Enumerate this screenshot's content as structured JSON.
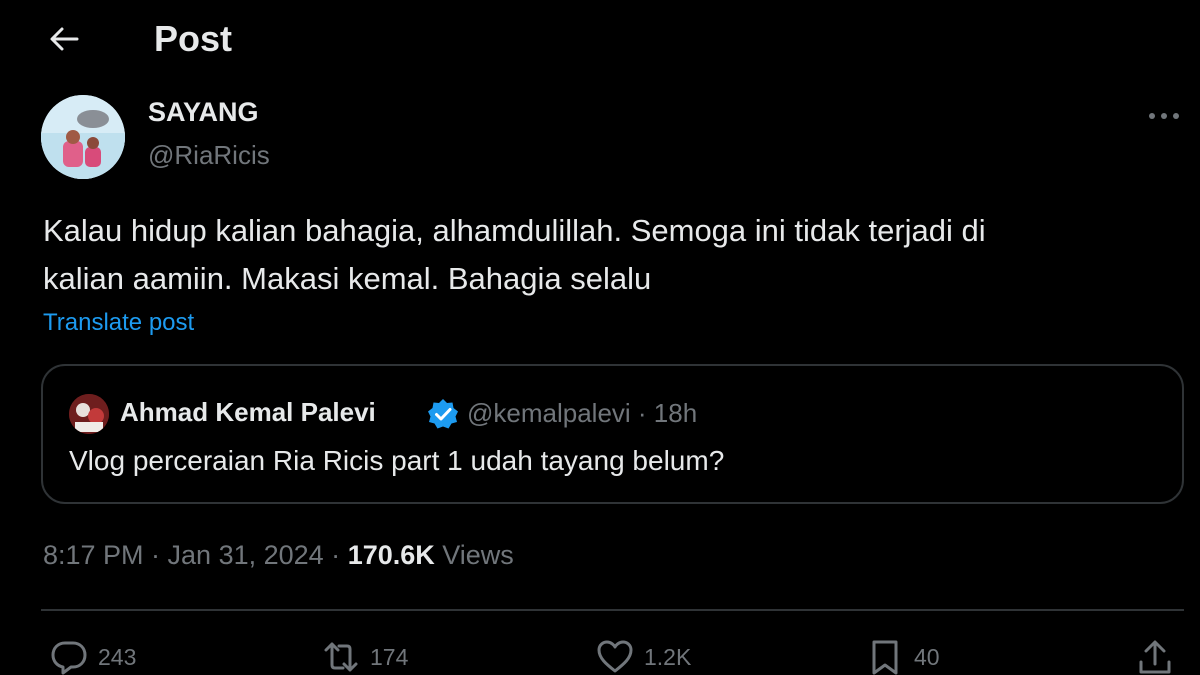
{
  "header": {
    "title": "Post"
  },
  "post": {
    "author_name": "SAYANG",
    "author_handle": "@RiaRicis",
    "text_line1": "Kalau hidup kalian bahagia, alhamdulillah. Semoga ini tidak terjadi di",
    "text_line2": "kalian aamiin. Makasi kemal. Bahagia selalu",
    "translate_label": "Translate post"
  },
  "quote": {
    "author_name": "Ahmad Kemal Palevi",
    "author_handle": "@kemalpalevi · 18h",
    "text": "Vlog perceraian Ria Ricis part 1 udah tayang belum?"
  },
  "meta": {
    "timestamp": "8:17 PM · Jan 31, 2024 · ",
    "views_count": "170.6K",
    "views_label": " Views"
  },
  "actions": {
    "replies": "243",
    "reposts": "174",
    "likes": "1.2K",
    "bookmarks": "40"
  },
  "icons": {
    "back": "arrow-left-icon",
    "more": "more-horizontal-icon",
    "verified": "verified-badge-icon",
    "reply": "reply-icon",
    "repost": "repost-icon",
    "like": "heart-icon",
    "bookmark": "bookmark-icon",
    "share": "share-icon"
  },
  "colors": {
    "background": "#000000",
    "text_primary": "#e7e9ea",
    "text_secondary": "#71767b",
    "accent": "#1d9bf0",
    "border": "#2f3336"
  }
}
